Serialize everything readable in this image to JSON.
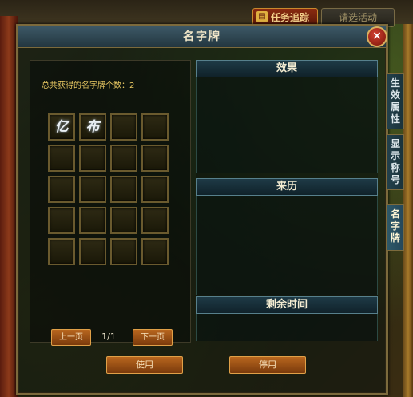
{
  "hud": {
    "quest_track_label": "任务追踪",
    "quest_track_icon": "quest-scroll-icon",
    "other_button_label": "请选活动"
  },
  "dialog": {
    "title": "名字牌",
    "close_icon": "×",
    "count_label": "总共获得的名字牌个数：2",
    "slots": [
      {
        "glyph": "亿"
      },
      {
        "glyph": "布"
      },
      {
        "glyph": ""
      },
      {
        "glyph": ""
      },
      {
        "glyph": ""
      },
      {
        "glyph": ""
      },
      {
        "glyph": ""
      },
      {
        "glyph": ""
      },
      {
        "glyph": ""
      },
      {
        "glyph": ""
      },
      {
        "glyph": ""
      },
      {
        "glyph": ""
      },
      {
        "glyph": ""
      },
      {
        "glyph": ""
      },
      {
        "glyph": ""
      },
      {
        "glyph": ""
      },
      {
        "glyph": ""
      },
      {
        "glyph": ""
      },
      {
        "glyph": ""
      },
      {
        "glyph": ""
      }
    ],
    "prev_page_label": "上一页",
    "next_page_label": "下一页",
    "page_indicator": "1/1",
    "sections": {
      "effect": "效果",
      "origin": "来历",
      "remaining_time": "剩余时间"
    },
    "use_button": "使用",
    "disable_button": "停用"
  },
  "side_tabs": [
    {
      "label": [
        "生",
        "效",
        "属",
        "性"
      ],
      "active": false
    },
    {
      "label": [
        "显",
        "示",
        "称",
        "号"
      ],
      "active": false
    },
    {
      "label": [
        "名",
        "字",
        "牌"
      ],
      "active": true
    }
  ]
}
